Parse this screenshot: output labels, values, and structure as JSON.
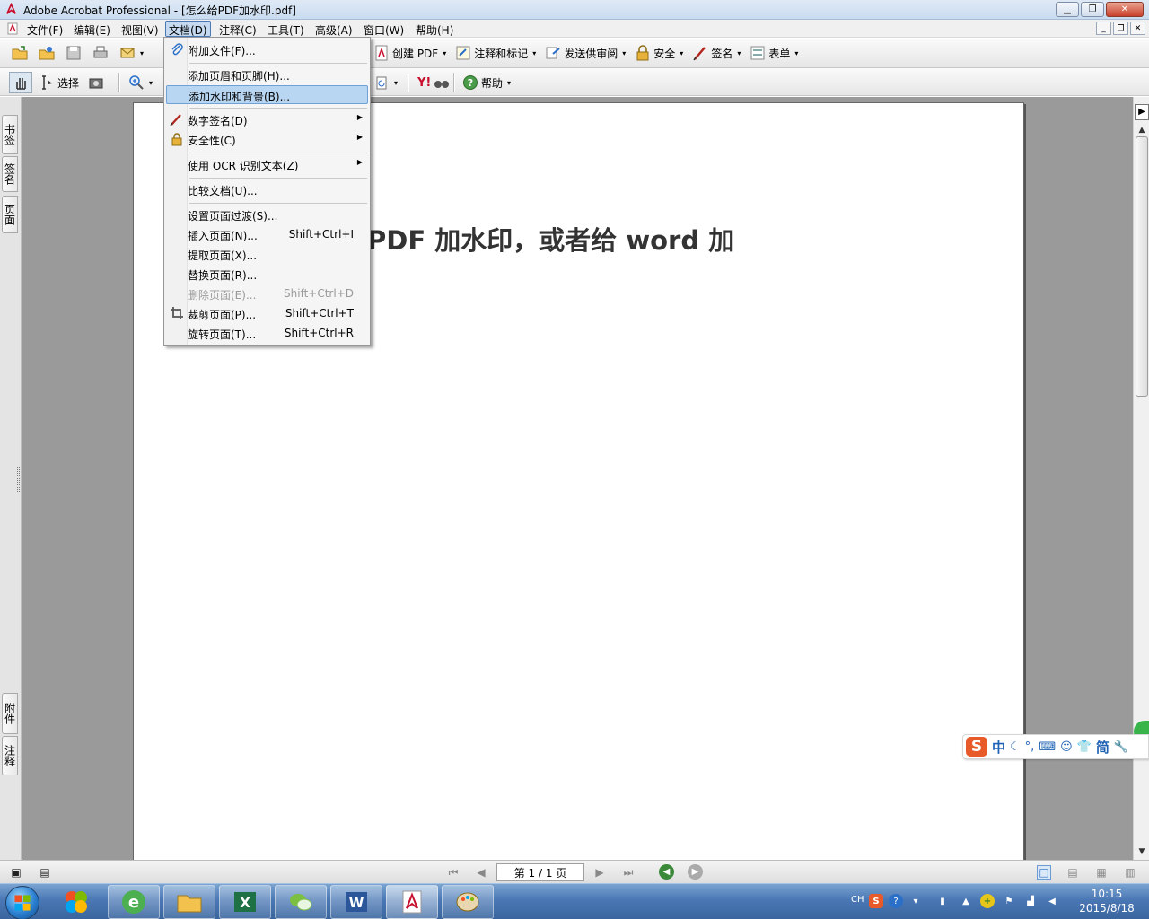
{
  "window": {
    "title": "Adobe Acrobat Professional - [怎么给PDF加水印.pdf]"
  },
  "menubar": {
    "items": [
      "文件(F)",
      "编辑(E)",
      "视图(V)",
      "文档(D)",
      "注释(C)",
      "工具(T)",
      "高级(A)",
      "窗口(W)",
      "帮助(H)"
    ],
    "active": "文档(D)"
  },
  "toolbar1": {
    "create_pdf": "创建 PDF",
    "comment_markup": "注释和标记",
    "send_review": "发送供审阅",
    "security": "安全",
    "sign": "签名",
    "forms": "表单"
  },
  "toolbar2": {
    "select": "选择",
    "help": "帮助"
  },
  "left_panel": {
    "tabs": [
      "书签",
      "签名",
      "页面",
      "附件",
      "注释"
    ]
  },
  "document_menu": {
    "items": [
      {
        "label": "附加文件(F)...",
        "shortcut": "",
        "icon": "paperclip-icon",
        "submenu": false,
        "disabled": false,
        "highlighted": false
      },
      {
        "label": "添加页眉和页脚(H)...",
        "shortcut": "",
        "icon": "",
        "submenu": false,
        "disabled": false,
        "highlighted": false
      },
      {
        "label": "添加水印和背景(B)...",
        "shortcut": "",
        "icon": "",
        "submenu": false,
        "disabled": false,
        "highlighted": true
      },
      {
        "label": "数字签名(D)",
        "shortcut": "",
        "icon": "pen-icon",
        "submenu": true,
        "disabled": false,
        "highlighted": false
      },
      {
        "label": "安全性(C)",
        "shortcut": "",
        "icon": "lock-icon",
        "submenu": true,
        "disabled": false,
        "highlighted": false
      },
      {
        "label": "使用 OCR 识别文本(Z)",
        "shortcut": "",
        "icon": "",
        "submenu": true,
        "disabled": false,
        "highlighted": false
      },
      {
        "label": "比较文档(U)...",
        "shortcut": "",
        "icon": "",
        "submenu": false,
        "disabled": false,
        "highlighted": false
      },
      {
        "label": "设置页面过渡(S)...",
        "shortcut": "",
        "icon": "",
        "submenu": false,
        "disabled": false,
        "highlighted": false
      },
      {
        "label": "插入页面(N)...",
        "shortcut": "Shift+Ctrl+I",
        "icon": "",
        "submenu": false,
        "disabled": false,
        "highlighted": false
      },
      {
        "label": "提取页面(X)...",
        "shortcut": "",
        "icon": "",
        "submenu": false,
        "disabled": false,
        "highlighted": false
      },
      {
        "label": "替换页面(R)...",
        "shortcut": "",
        "icon": "",
        "submenu": false,
        "disabled": false,
        "highlighted": false
      },
      {
        "label": "删除页面(E)...",
        "shortcut": "Shift+Ctrl+D",
        "icon": "",
        "submenu": false,
        "disabled": true,
        "highlighted": false
      },
      {
        "label": "裁剪页面(P)...",
        "shortcut": "Shift+Ctrl+T",
        "icon": "crop-icon",
        "submenu": false,
        "disabled": false,
        "highlighted": false
      },
      {
        "label": "旋转页面(T)...",
        "shortcut": "Shift+Ctrl+R",
        "icon": "",
        "submenu": false,
        "disabled": false,
        "highlighted": false
      }
    ]
  },
  "document": {
    "visible_text": "PDF 加水印，或者给 word 加"
  },
  "statusbar": {
    "page_indicator": "第 1 / 1 页"
  },
  "ime": {
    "mode": "中",
    "simplified": "简"
  },
  "taskbar": {
    "tray_lang": "CH",
    "time": "10:15",
    "date": "2015/8/18"
  },
  "colors": {
    "menu_highlight": "#b8d5f1",
    "taskbar": "#4a78b5",
    "doc_background": "#9a9a9a"
  }
}
